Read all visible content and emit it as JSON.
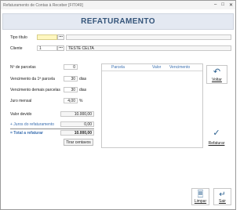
{
  "window": {
    "title": "Refaturamento de Contas à Receber [FIT049]"
  },
  "header": {
    "title": "REFATURAMENTO"
  },
  "form": {
    "tipo_titulo_label": "Tipo título",
    "tipo_titulo_value": "",
    "tipo_titulo_desc": "",
    "cliente_label": "Cliente",
    "cliente_code": "1",
    "cliente_name": "TESTE CELTA",
    "n_parcelas_label": "Nº de parcelas",
    "n_parcelas_value": "0",
    "venc_primeira_label": "Vencimento da 1ª parcela",
    "venc_primeira_value": "30",
    "venc_primeira_unit": "dias",
    "venc_demais_label": "Vencimento demais parcelas",
    "venc_demais_value": "30",
    "venc_demais_unit": "dias",
    "juro_label": "Juro mensal",
    "juro_value": "4,00",
    "juro_unit": "%",
    "valor_devido_label": "Valor devido",
    "valor_devido_value": "10.000,00",
    "juros_label": "+ Juros do refaturamento",
    "juros_value": "0,00",
    "total_label": "= Total a refaturar",
    "total_value": "10.000,00",
    "tirar_centavos_label": "Tirar centavos"
  },
  "grid": {
    "columns": [
      "Parcela",
      "Valor",
      "Vencimento"
    ]
  },
  "buttons": {
    "dots": "...",
    "voltar": "Voltar",
    "refaturar": "Refaturar",
    "limpar": "Limpar",
    "sair": "Sair"
  },
  "colors": {
    "header_bg": "#e4e9f2",
    "header_text": "#35557a",
    "accent_blue": "#3a6fb0",
    "input_yellow": "#fff7c0"
  }
}
